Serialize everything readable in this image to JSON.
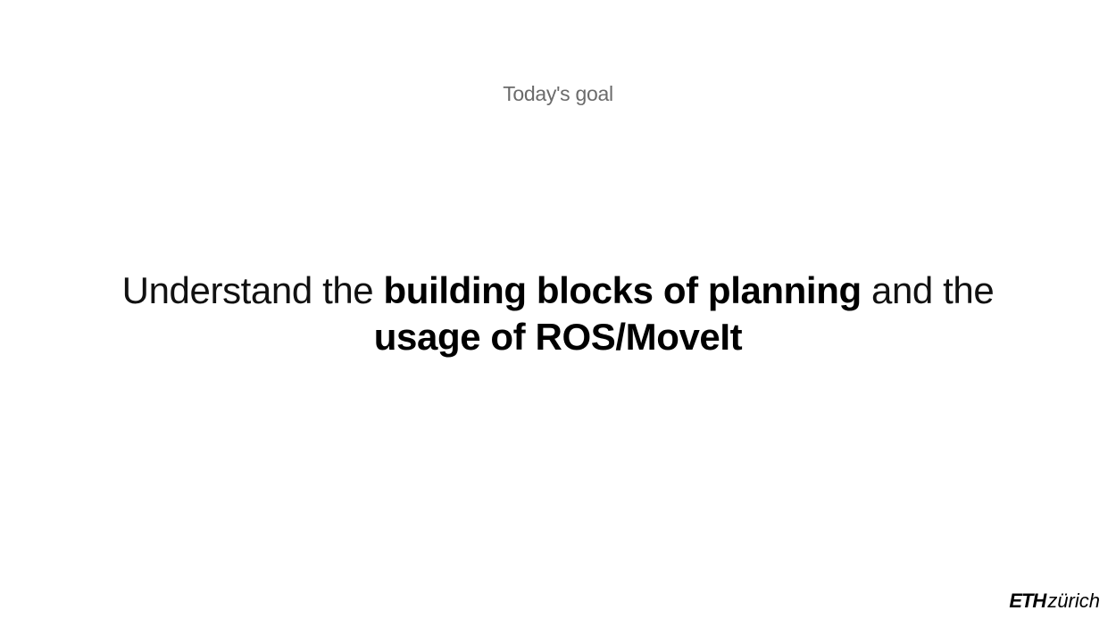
{
  "slide": {
    "subtitle": "Today's goal",
    "goal": {
      "part1": "Understand the ",
      "emphasis1": "building blocks of planning",
      "part2": " and the ",
      "emphasis2": "usage of ROS/MoveIt"
    }
  },
  "logo": {
    "eth": "ETH",
    "zurich": "zürich"
  }
}
